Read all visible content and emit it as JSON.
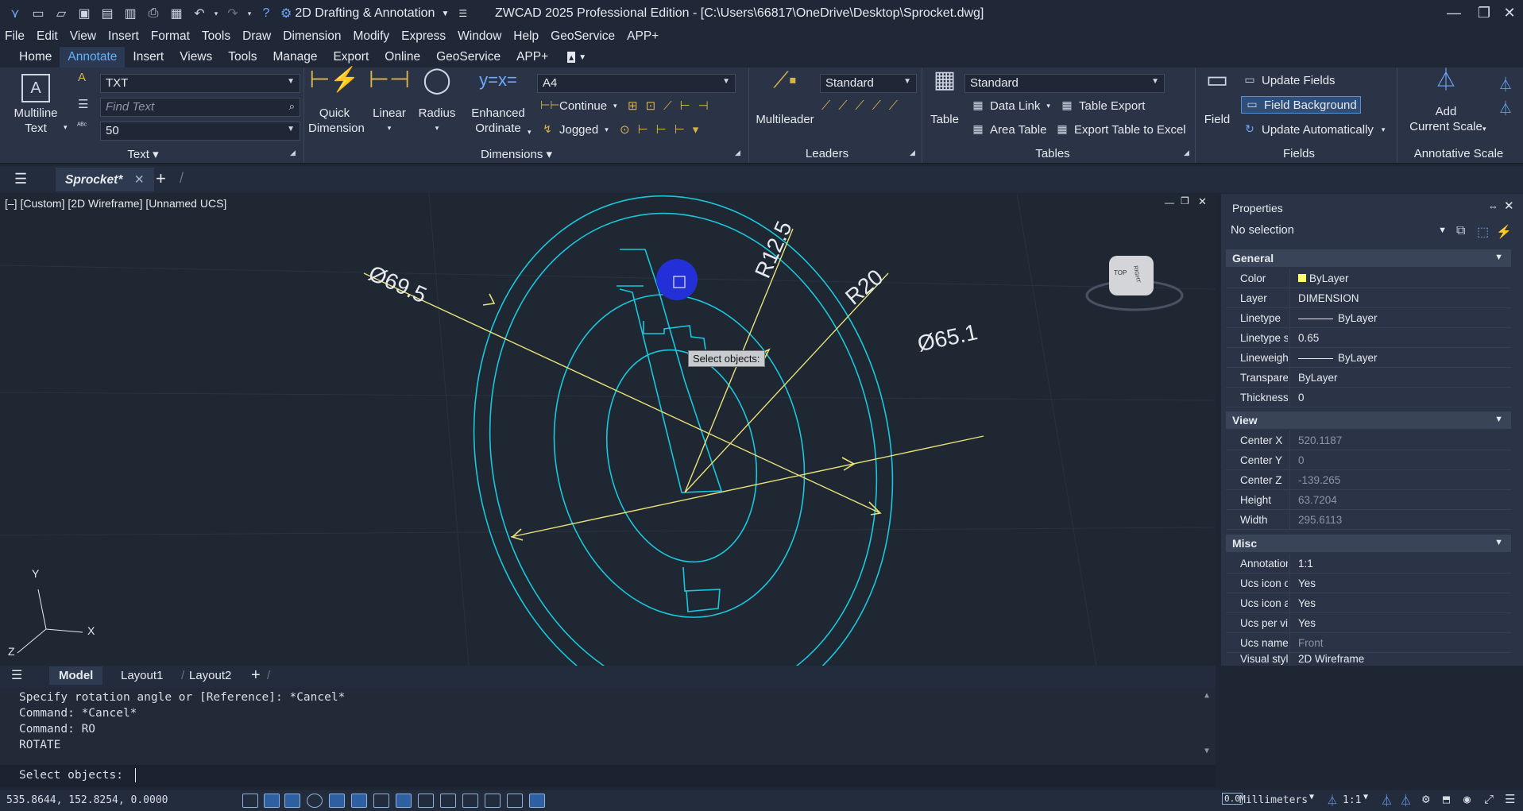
{
  "app": {
    "title": "ZWCAD 2025 Professional Edition - [C:\\Users\\66817\\OneDrive\\Desktop\\Sprocket.dwg]",
    "workspace": "2D Drafting & Annotation"
  },
  "menubar": [
    "File",
    "Edit",
    "View",
    "Insert",
    "Format",
    "Tools",
    "Draw",
    "Dimension",
    "Modify",
    "Express",
    "Window",
    "Help",
    "GeoService",
    "APP+"
  ],
  "ribbon_tabs": [
    "Home",
    "Annotate",
    "Insert",
    "Views",
    "Tools",
    "Manage",
    "Export",
    "Online",
    "GeoService",
    "APP+"
  ],
  "ribbon_active_tab": "Annotate",
  "ribbon": {
    "text_panel": {
      "title": "Text",
      "multiline_label": "Multiline\nText",
      "style_value": "TXT",
      "find_placeholder": "Find Text",
      "height_value": "50"
    },
    "dimensions_panel": {
      "title": "Dimensions",
      "quick": "Quick\nDimension",
      "linear": "Linear",
      "radius": "Radius",
      "enhanced": "Enhanced\nOrdinate",
      "dimstyle_value": "A4",
      "continue": "Continue",
      "jogged": "Jogged"
    },
    "leaders_panel": {
      "title": "Leaders",
      "multileader": "Multileader",
      "style_value": "Standard"
    },
    "tables_panel": {
      "title": "Tables",
      "table": "Table",
      "style_value": "Standard",
      "data_link": "Data Link",
      "table_export": "Table Export",
      "area_table": "Area Table",
      "export_excel": "Export Table to Excel"
    },
    "fields_panel": {
      "title": "Fields",
      "field": "Field",
      "update_fields": "Update Fields",
      "field_background": "Field Background",
      "update_auto": "Update Automatically"
    },
    "annoscale_panel": {
      "title": "Annotative Scale",
      "add_scale": "Add\nCurrent Scale"
    }
  },
  "doc_tab": "Sprocket*",
  "viewport": {
    "title": "[–] [Custom] [2D Wireframe] [Unnamed UCS]",
    "tooltip": "Select objects:",
    "dims": [
      "Ø69.5",
      "R12.5",
      "R20",
      "Ø65.1"
    ],
    "axes": {
      "x": "X",
      "y": "Y",
      "z": "Z"
    },
    "viewcube": {
      "top": "TOP",
      "right": "RIGHT"
    }
  },
  "properties": {
    "header": "Properties",
    "selection": "No selection",
    "sections": {
      "general": "General",
      "view": "View",
      "misc": "Misc"
    },
    "general": [
      {
        "k": "Color",
        "v": "ByLayer"
      },
      {
        "k": "Layer",
        "v": "DIMENSION"
      },
      {
        "k": "Linetype",
        "v": "ByLayer"
      },
      {
        "k": "Linetype sc...",
        "v": "0.65"
      },
      {
        "k": "Lineweight",
        "v": "ByLayer"
      },
      {
        "k": "Transparen...",
        "v": "ByLayer"
      },
      {
        "k": "Thickness",
        "v": "0"
      }
    ],
    "view": [
      {
        "k": "Center X",
        "v": "520.1187"
      },
      {
        "k": "Center Y",
        "v": "0"
      },
      {
        "k": "Center Z",
        "v": "-139.265"
      },
      {
        "k": "Height",
        "v": "63.7204"
      },
      {
        "k": "Width",
        "v": "295.6113"
      }
    ],
    "misc": [
      {
        "k": "Annotation...",
        "v": "1:1"
      },
      {
        "k": "Ucs icon on",
        "v": "Yes"
      },
      {
        "k": "Ucs icon at...",
        "v": "Yes"
      },
      {
        "k": "Ucs per vie...",
        "v": "Yes"
      },
      {
        "k": "Ucs name",
        "v": "Front"
      },
      {
        "k": "Visual style",
        "v": "2D Wireframe"
      }
    ]
  },
  "layout_tabs": [
    "Model",
    "Layout1",
    "Layout2"
  ],
  "command_history": [
    "Specify rotation angle or [Reference]: *Cancel*",
    "Command: *Cancel*",
    "Command: RO",
    "ROTATE"
  ],
  "command_prompt": "Select objects:",
  "status": {
    "coords": "535.8644, 152.8254, 0.0000",
    "units": "Millimeters",
    "scale": "1:1"
  }
}
